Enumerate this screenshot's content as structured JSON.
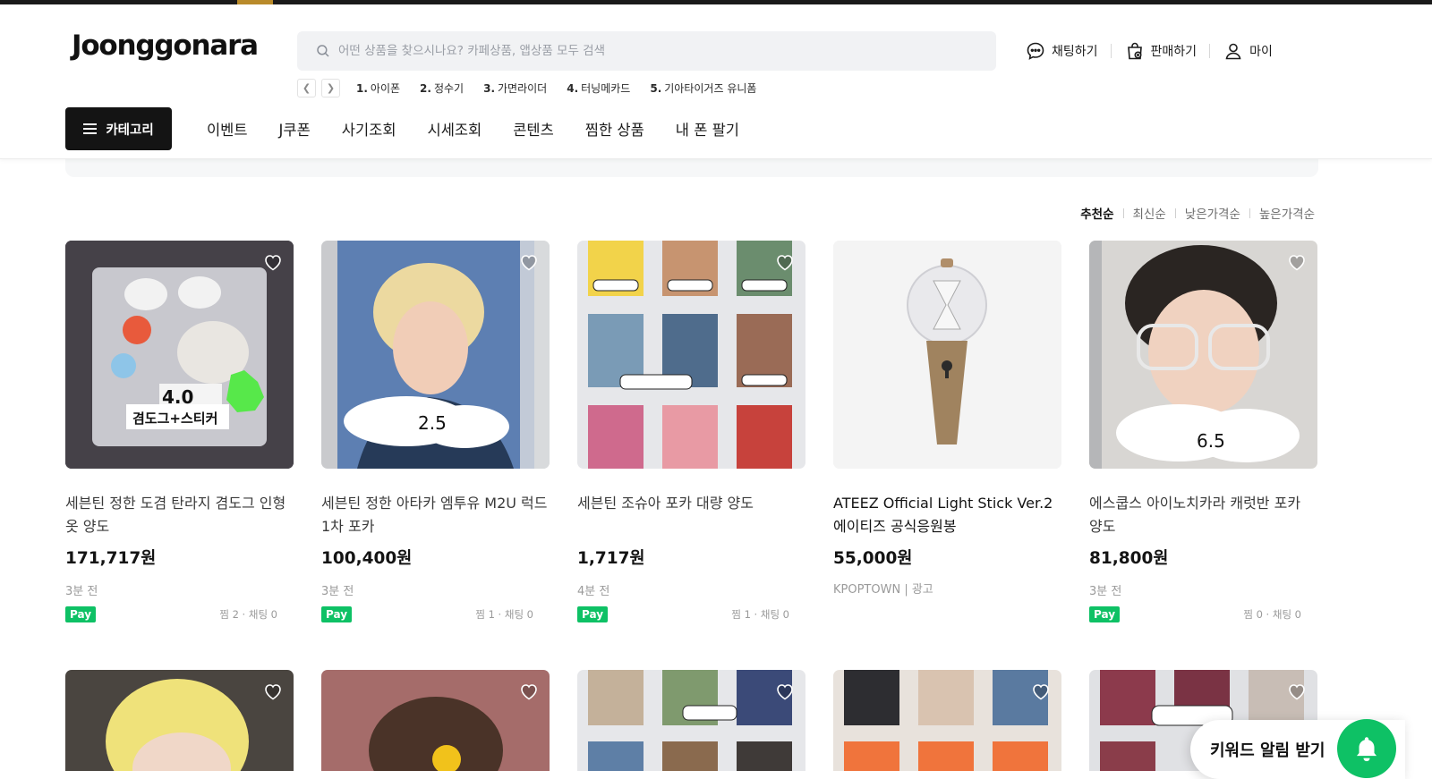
{
  "header": {
    "logo": "Joonggonara",
    "search_placeholder": "어떤 상품을 찾으시나요? 카페상품, 앱상품 모두 검색",
    "nav": [
      {
        "label": "채팅하기",
        "icon": "chat-icon"
      },
      {
        "label": "판매하기",
        "icon": "sell-bag-icon"
      },
      {
        "label": "마이",
        "icon": "user-icon"
      }
    ],
    "trending": [
      {
        "rank": "1.",
        "label": "아이폰"
      },
      {
        "rank": "2.",
        "label": "정수기"
      },
      {
        "rank": "3.",
        "label": "가면라이더"
      },
      {
        "rank": "4.",
        "label": "터닝메카드"
      },
      {
        "rank": "5.",
        "label": "기아타이거즈 유니폼"
      }
    ],
    "category_button": "카테고리",
    "menu": [
      "이벤트",
      "J쿠폰",
      "사기조회",
      "시세조회",
      "콘텐츠",
      "찜한 상품",
      "내 폰 팔기"
    ]
  },
  "sort": {
    "options": [
      "추천순",
      "최신순",
      "낮은가격순",
      "높은가격순"
    ],
    "active": "추천순"
  },
  "products": [
    {
      "title": "세븐틴 정한 도겸 탄라지 겸도그 인형 옷 양도",
      "price": "171,717원",
      "time": "3분 전",
      "pay": "Pay",
      "stats": "찜 2 · 채팅 0",
      "image_text": [
        "4.0",
        "겸도그+스티커"
      ]
    },
    {
      "title": "세븐틴 정한 아타카 엠투유 M2U 럭드 1차 포카",
      "price": "100,400원",
      "time": "3분 전",
      "pay": "Pay",
      "stats": "찜 1 · 채팅 0",
      "image_text": [
        "2.5"
      ]
    },
    {
      "title": "세븐틴 조슈아 포카 대량 양도",
      "price": "1,717원",
      "time": "4분 전",
      "pay": "Pay",
      "stats": "찜 1 · 채팅 0",
      "image_text": []
    },
    {
      "title": "ATEEZ Official Light Stick Ver.2 에이티즈 공식응원봉",
      "price": "55,000원",
      "time": "KPOPTOWN | 광고",
      "pay": "",
      "stats": "",
      "image_text": []
    },
    {
      "title": "에스쿱스 아이노치카라 캐럿반 포카 양도",
      "price": "81,800원",
      "time": "3분 전",
      "pay": "Pay",
      "stats": "찜 0 · 채팅 0",
      "image_text": [
        "6.5"
      ]
    }
  ],
  "floating": {
    "keyword_alert": "키워드 알림 받기"
  },
  "colors": {
    "accent_green": "#0ec165",
    "dark": "#141414"
  }
}
